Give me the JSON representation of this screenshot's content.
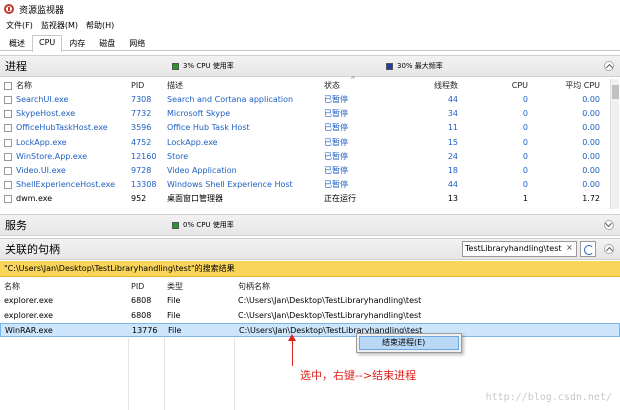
{
  "window": {
    "title": "资源监视器"
  },
  "menu": [
    "文件(F)",
    "监视器(M)",
    "帮助(H)"
  ],
  "tabs": [
    {
      "label": "概述",
      "active": false
    },
    {
      "label": "CPU",
      "active": true
    },
    {
      "label": "内存",
      "active": false
    },
    {
      "label": "磁盘",
      "active": false
    },
    {
      "label": "网络",
      "active": false
    }
  ],
  "processes": {
    "title": "进程",
    "legend_usage": "3% CPU 使用率",
    "legend_max": "30% 最大频率",
    "legend_usage_color": "#1f9e1f",
    "legend_max_color": "#1b3fa5",
    "columns": [
      "名称",
      "PID",
      "描述",
      "状态",
      "线程数",
      "CPU",
      "平均 CPU"
    ],
    "rows": [
      {
        "name": "SearchUI.exe",
        "pid": "7308",
        "desc": "Search and Cortana application",
        "status": "已暂停",
        "threads": "44",
        "cpu": "0",
        "avg": "0.00",
        "suspended": true
      },
      {
        "name": "SkypeHost.exe",
        "pid": "7732",
        "desc": "Microsoft Skype",
        "status": "已暂停",
        "threads": "34",
        "cpu": "0",
        "avg": "0.00",
        "suspended": true
      },
      {
        "name": "OfficeHubTaskHost.exe",
        "pid": "3596",
        "desc": "Office Hub Task Host",
        "status": "已暂停",
        "threads": "11",
        "cpu": "0",
        "avg": "0.00",
        "suspended": true
      },
      {
        "name": "LockApp.exe",
        "pid": "4752",
        "desc": "LockApp.exe",
        "status": "已暂停",
        "threads": "15",
        "cpu": "0",
        "avg": "0.00",
        "suspended": true
      },
      {
        "name": "WinStore.App.exe",
        "pid": "12160",
        "desc": "Store",
        "status": "已暂停",
        "threads": "24",
        "cpu": "0",
        "avg": "0.00",
        "suspended": true
      },
      {
        "name": "Video.UI.exe",
        "pid": "9728",
        "desc": "Video Application",
        "status": "已暂停",
        "threads": "18",
        "cpu": "0",
        "avg": "0.00",
        "suspended": true
      },
      {
        "name": "ShellExperienceHost.exe",
        "pid": "13308",
        "desc": "Windows Shell Experience Host",
        "status": "已暂停",
        "threads": "44",
        "cpu": "0",
        "avg": "0.00",
        "suspended": true
      },
      {
        "name": "dwm.exe",
        "pid": "952",
        "desc": "桌面窗口管理器",
        "status": "正在运行",
        "threads": "13",
        "cpu": "1",
        "avg": "1.72",
        "suspended": false
      }
    ]
  },
  "services": {
    "title": "服务",
    "legend_usage": "0% CPU 使用率",
    "legend_usage_color": "#1f9e1f"
  },
  "handles": {
    "title": "关联的句柄",
    "search_value": "TestLibraryhandling\\test",
    "search_clear": "×",
    "result_text": "\"C:\\Users\\Jan\\Desktop\\TestLibraryhandling\\test\"的搜索结果",
    "columns": [
      "名称",
      "PID",
      "类型",
      "句柄名称"
    ],
    "rows": [
      {
        "name": "explorer.exe",
        "pid": "6808",
        "type": "File",
        "handle": "C:\\Users\\Jan\\Desktop\\TestLibraryhandling\\test"
      },
      {
        "name": "explorer.exe",
        "pid": "6808",
        "type": "File",
        "handle": "C:\\Users\\Jan\\Desktop\\TestLibraryhandling\\test"
      },
      {
        "name": "WinRAR.exe",
        "pid": "13776",
        "type": "File",
        "handle": "C:\\Users\\Jan\\Desktop\\TestLibraryhandling\\test"
      }
    ],
    "selected_row": 2
  },
  "context_menu": {
    "item": "结束进程(E)"
  },
  "annotation": "选中，右键-->结束进程",
  "watermark": "http://blog.csdn.net/"
}
